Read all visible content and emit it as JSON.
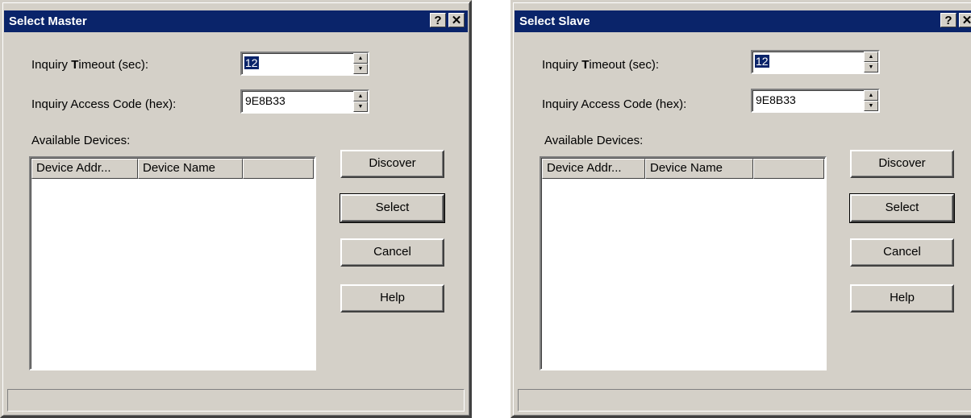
{
  "master": {
    "title": "Select Master",
    "help_button": "?",
    "close_button": "✕",
    "inquiry_timeout": {
      "label_pre": "Inquiry ",
      "label_key": "T",
      "label_post": "imeout (sec):",
      "value": "12"
    },
    "access_code": {
      "label": "Inquiry Access Code (hex):",
      "value": "9E8B33"
    },
    "available_label": "Available Devices:",
    "columns": [
      "Device Addr...",
      "Device Name",
      ""
    ],
    "buttons": {
      "discover": "Discover",
      "select": "Select",
      "cancel": "Cancel",
      "help": "Help"
    },
    "status": ""
  },
  "slave": {
    "title": "Select Slave",
    "help_button": "?",
    "close_button": "✕",
    "inquiry_timeout": {
      "label_pre": "Inquiry ",
      "label_key": "T",
      "label_post": "imeout (sec):",
      "value": "12"
    },
    "access_code": {
      "label": "Inquiry Access Code (hex):",
      "value": "9E8B33"
    },
    "available_label": "Available Devices:",
    "columns": [
      "Device Addr...",
      "Device Name",
      ""
    ],
    "buttons": {
      "discover": "Discover",
      "select": "Select",
      "cancel": "Cancel",
      "help": "Help"
    },
    "status": ""
  },
  "spin_glyphs": {
    "up": "▲",
    "down": "▼"
  },
  "colors": {
    "titlebar": "#0a246a",
    "face": "#d4d0c8",
    "selection": "#0a246a"
  }
}
